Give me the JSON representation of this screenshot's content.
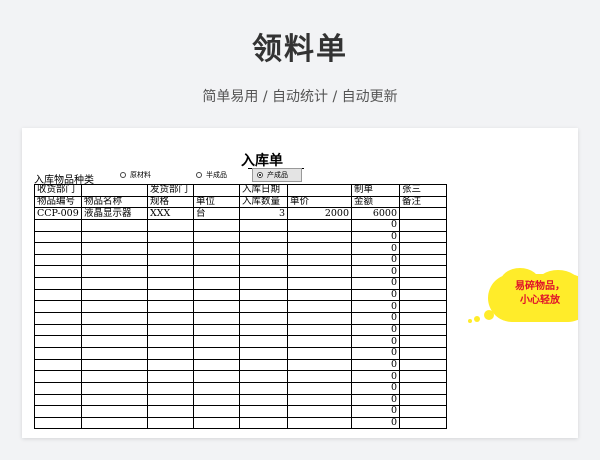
{
  "page": {
    "title": "领料单",
    "subtitle": "简单易用  /  自动统计  /  自动更新"
  },
  "form": {
    "title": "入库单",
    "kind_label": "入库物品种类",
    "options": [
      {
        "label": "原材料",
        "selected": false
      },
      {
        "label": "半成品",
        "selected": false
      },
      {
        "label": "产成品",
        "selected": true
      }
    ],
    "header_row1": [
      "收货部门",
      "",
      "发货部门",
      "",
      "入库日期",
      "",
      "制单",
      "张三"
    ],
    "header_row2": [
      "物品编号",
      "物品名称",
      "规格",
      "单位",
      "入库数量",
      "单价",
      "金额",
      "备注"
    ],
    "rows": [
      [
        "CCP-009",
        "液晶显示器",
        "XXX",
        "台",
        "3",
        "2000",
        "6000",
        ""
      ],
      [
        "",
        "",
        "",
        "",
        "",
        "",
        "0",
        ""
      ],
      [
        "",
        "",
        "",
        "",
        "",
        "",
        "0",
        ""
      ],
      [
        "",
        "",
        "",
        "",
        "",
        "",
        "0",
        ""
      ],
      [
        "",
        "",
        "",
        "",
        "",
        "",
        "0",
        ""
      ],
      [
        "",
        "",
        "",
        "",
        "",
        "",
        "0",
        ""
      ],
      [
        "",
        "",
        "",
        "",
        "",
        "",
        "0",
        ""
      ],
      [
        "",
        "",
        "",
        "",
        "",
        "",
        "0",
        ""
      ],
      [
        "",
        "",
        "",
        "",
        "",
        "",
        "0",
        ""
      ],
      [
        "",
        "",
        "",
        "",
        "",
        "",
        "0",
        ""
      ],
      [
        "",
        "",
        "",
        "",
        "",
        "",
        "0",
        ""
      ],
      [
        "",
        "",
        "",
        "",
        "",
        "",
        "0",
        ""
      ],
      [
        "",
        "",
        "",
        "",
        "",
        "",
        "0",
        ""
      ],
      [
        "",
        "",
        "",
        "",
        "",
        "",
        "0",
        ""
      ],
      [
        "",
        "",
        "",
        "",
        "",
        "",
        "0",
        ""
      ],
      [
        "",
        "",
        "",
        "",
        "",
        "",
        "0",
        ""
      ],
      [
        "",
        "",
        "",
        "",
        "",
        "",
        "0",
        ""
      ],
      [
        "",
        "",
        "",
        "",
        "",
        "",
        "0",
        ""
      ],
      [
        "",
        "",
        "",
        "",
        "",
        "",
        "0",
        ""
      ]
    ]
  },
  "callout": {
    "line1": "易碎物品，",
    "line2": "小心轻放",
    "color": "#ffec2a",
    "text_color": "#e0102a"
  }
}
